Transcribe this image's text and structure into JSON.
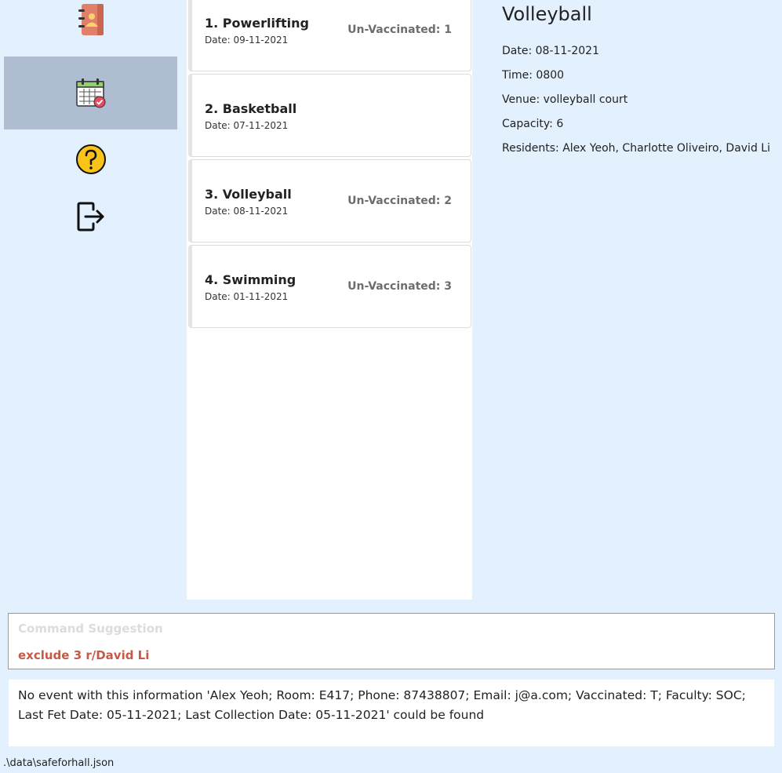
{
  "sidebar": {
    "items": [
      {
        "icon": "contacts-book-icon",
        "active": false
      },
      {
        "icon": "calendar-icon",
        "active": true
      },
      {
        "icon": "help-icon",
        "active": false
      },
      {
        "icon": "logout-icon",
        "active": false
      }
    ]
  },
  "events": [
    {
      "title": "1.  Powerlifting",
      "date": "Date: 09-11-2021",
      "unvaccinated": "Un-Vaccinated: 1"
    },
    {
      "title": "2.  Basketball",
      "date": "Date: 07-11-2021",
      "unvaccinated": ""
    },
    {
      "title": "3.  Volleyball",
      "date": "Date: 08-11-2021",
      "unvaccinated": "Un-Vaccinated: 2"
    },
    {
      "title": "4.  Swimming",
      "date": "Date: 01-11-2021",
      "unvaccinated": "Un-Vaccinated: 3"
    }
  ],
  "detail": {
    "title": "Volleyball",
    "date": "Date: 08-11-2021",
    "time": "Time: 0800",
    "venue": "Venue: volleyball court",
    "capacity": "Capacity: 6",
    "residents": "Residents: Alex Yeoh, Charlotte Oliveiro, David Li"
  },
  "command": {
    "placeholder": "Command Suggestion",
    "text": "exclude 3 r/David Li"
  },
  "result": {
    "text": "No event with this information 'Alex Yeoh; Room: E417; Phone: 87438807; Email: j@a.com; Vaccinated: T; Faculty: SOC; Last Fet Date: 05-11-2021; Last Collection Date: 05-11-2021' could be found"
  },
  "status": {
    "path": ".\\data\\safeforhall.json"
  },
  "colors": {
    "background": "#e3f0fd",
    "active_nav": "#aebdd1",
    "command_text": "#c45a47"
  }
}
